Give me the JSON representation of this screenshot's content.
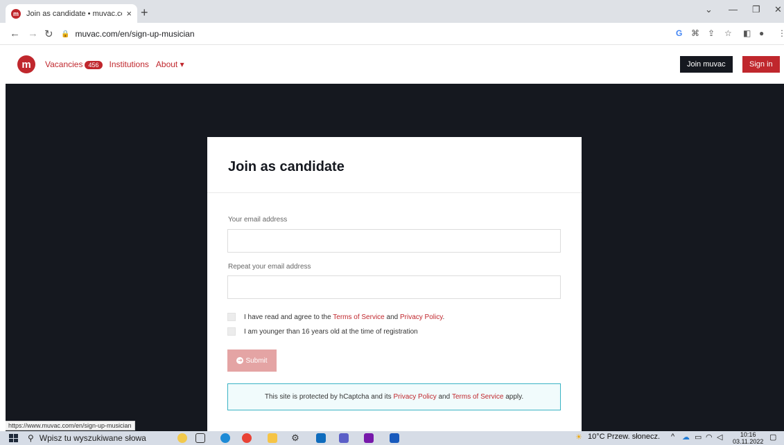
{
  "browser": {
    "tab_title": "Join as candidate • muvac.com",
    "favicon_letter": "m",
    "tab_close": "×",
    "new_tab": "+",
    "url": "muvac.com/en/sign-up-musician",
    "status_url": "https://www.muvac.com/en/sign-up-musician"
  },
  "site": {
    "logo_letter": "m",
    "nav": {
      "vacancies_label": "Vacancies",
      "vacancies_count": "456",
      "institutions_label": "Institutions",
      "about_label": "About ▾"
    },
    "join_label": "Join muvac",
    "signin_label": "Sign in"
  },
  "form": {
    "title": "Join as candidate",
    "email_label": "Your email address",
    "repeat_email_label": "Repeat your email address",
    "agree_prefix": "I have read and agree to the",
    "terms_link": "Terms of Service",
    "agree_and": "and",
    "privacy_link": "Privacy Policy",
    "agree_suffix": ".",
    "younger_label": "I am younger than 16 years old at the time of registration",
    "submit_label": "Submit",
    "captcha_prefix": "This site is protected by hCaptcha and its",
    "captcha_privacy": "Privacy Policy",
    "captcha_and": "and",
    "captcha_terms": "Terms of Service",
    "captcha_suffix": "apply."
  },
  "taskbar": {
    "search_placeholder": "Wpisz tu wyszukiwane słowa",
    "weather": "10°C  Przew. słonecz.",
    "time": "10:16",
    "date": "03.11.2022"
  },
  "colors": {
    "brand_red": "#c0272d",
    "dark_bg": "#15181f",
    "submit_disabled": "#e4a4a4",
    "captcha_border": "#39b3c4"
  }
}
